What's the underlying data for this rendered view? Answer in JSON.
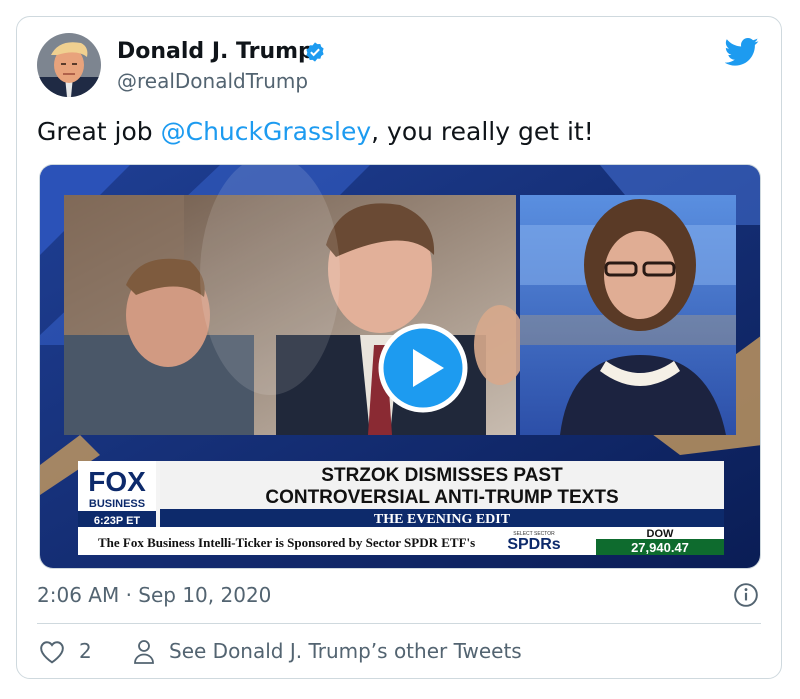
{
  "author": {
    "name": "Donald J. Trump",
    "handle": "@realDonaldTrump"
  },
  "tweet": {
    "text_before": "Great job ",
    "mention": "@ChuckGrassley",
    "text_after": ", you really get it!"
  },
  "video": {
    "network_logo_top": "FOX",
    "network_logo_bottom": "BUSINESS",
    "clock": "6:23P ET",
    "headline_line1": "STRZOK DISMISSES PAST",
    "headline_line2": "CONTROVERSIAL ANTI-TRUMP TEXTS",
    "show_name": "THE EVENING EDIT",
    "ticker_text": "The Fox Business Intelli-Ticker is Sponsored by Sector SPDR ETF's",
    "ticker_brand": "SPDRs",
    "ticker_brand_small": "SELECT SECTOR",
    "index_name": "DOW",
    "index_value": "27,940.47"
  },
  "meta": {
    "timestamp": "2:06 AM · Sep 10, 2020",
    "like_count": "2",
    "see_other": "See Donald J. Trump’s other Tweets"
  },
  "colors": {
    "link_blue": "#1d9bf0",
    "secondary_text": "#536471",
    "border": "#cfd9de",
    "fox_navy": "#0d2a6b",
    "dow_green": "#0e6b2e"
  },
  "icons": [
    "verified-badge-icon",
    "twitter-bird-icon",
    "play-icon",
    "info-icon",
    "heart-icon",
    "person-icon"
  ]
}
